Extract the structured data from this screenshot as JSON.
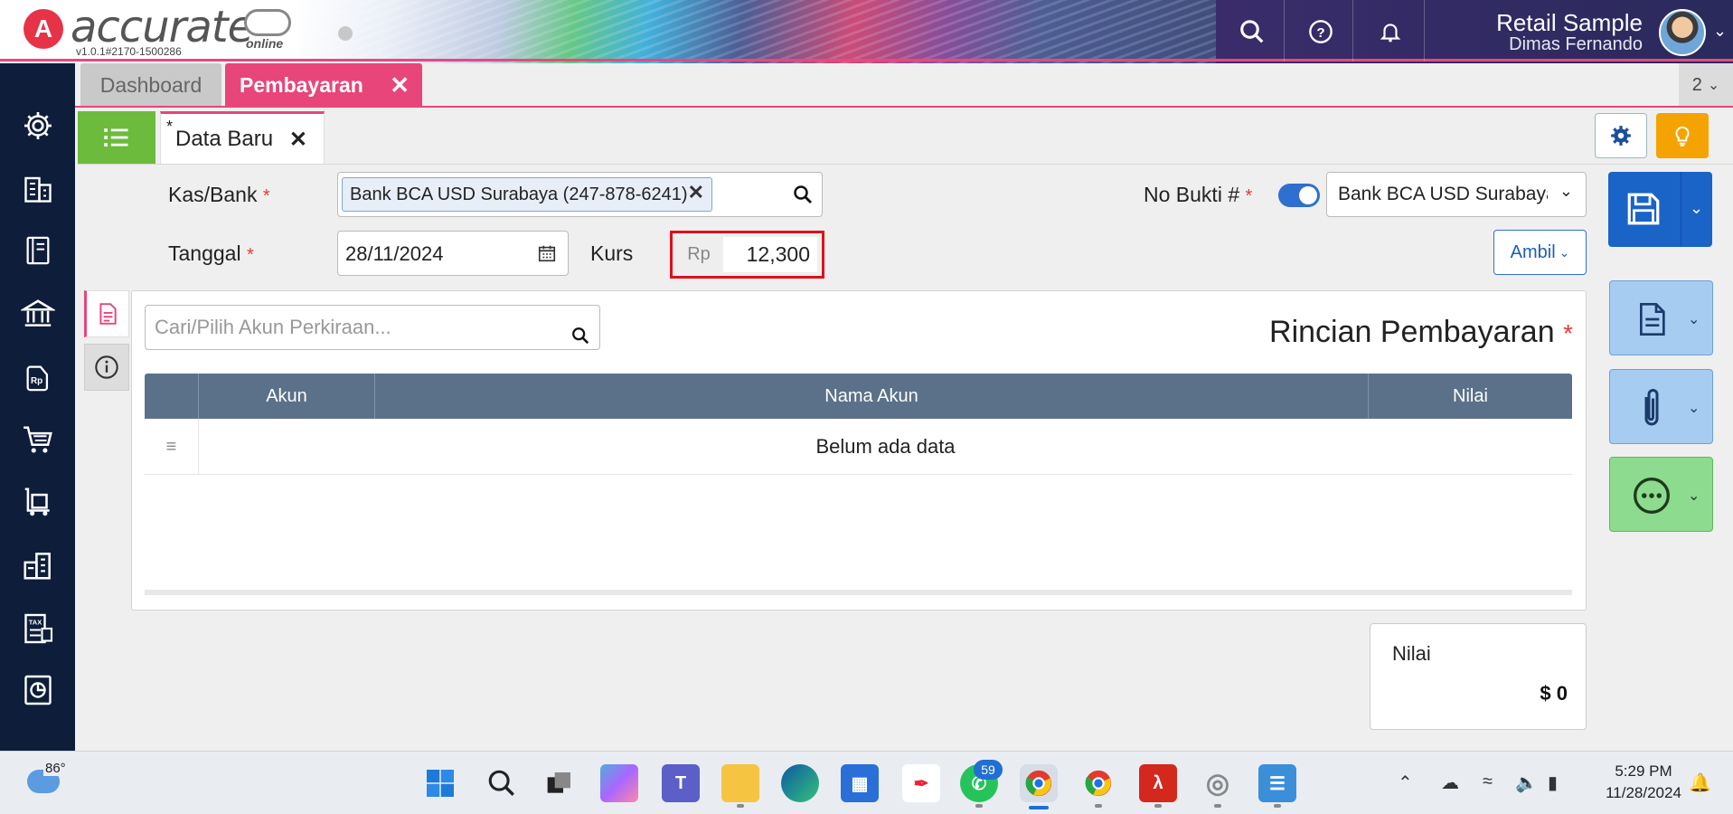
{
  "header": {
    "logo_letter": "A",
    "logo_text": "accurate",
    "logo_sub": "online",
    "version": "v1.0.1#2170-1500286",
    "company": "Retail Sample",
    "user": "Dimas Fernando"
  },
  "tabs": {
    "dashboard": "Dashboard",
    "active": "Pembayaran",
    "close": "✕",
    "count": "2"
  },
  "subtab": {
    "modified_marker": "*",
    "label": "Data Baru",
    "close": "✕"
  },
  "form": {
    "kas_bank_label": "Kas/Bank",
    "kas_bank_value": "Bank BCA USD Surabaya (247-878-6241)",
    "no_bukti_label": "No Bukti #",
    "no_bukti_value": "Bank BCA USD Surabaya (",
    "no_bukti_toggle_on": true,
    "tanggal_label": "Tanggal",
    "tanggal_value": "28/11/2024",
    "kurs_label": "Kurs",
    "kurs_currency": "Rp",
    "kurs_value": "12,300",
    "ambil_label": "Ambil",
    "required_mark": "*"
  },
  "detail": {
    "search_placeholder": "Cari/Pilih Akun Perkiraan...",
    "title": "Rincian Pembayaran",
    "columns": [
      "Akun",
      "Nama Akun",
      "Nilai"
    ],
    "empty_text": "Belum ada data",
    "rows": []
  },
  "summary": {
    "nilai_label": "Nilai",
    "nilai_value": "$ 0"
  },
  "sidebar": {
    "items": [
      "gear-icon",
      "building-icon",
      "book-icon",
      "bank-icon",
      "price-tag-icon",
      "cart-icon",
      "inventory-cart-icon",
      "factory-icon",
      "tax-icon",
      "report-icon"
    ]
  },
  "taskbar": {
    "temperature": "86°",
    "whatsapp_badge": "59",
    "time": "5:29 PM",
    "date": "11/28/2024"
  },
  "colors": {
    "accent_pink": "#e8457a",
    "primary_blue": "#1a63c7",
    "sidebar_navy": "#0e1d3a",
    "list_green": "#6dbb3c",
    "highlight_red": "#e0101a"
  }
}
